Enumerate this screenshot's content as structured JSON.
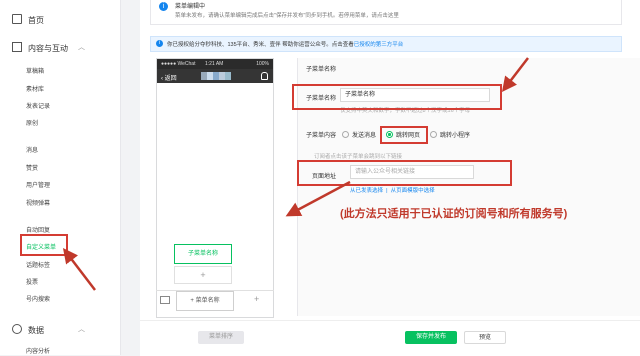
{
  "sidebar": {
    "home": "首页",
    "content_group": "内容与互动",
    "content_items": [
      "草稿箱",
      "素材库",
      "发表记录",
      "原创"
    ],
    "interaction_items": [
      "消息",
      "赞赏",
      "用户管理",
      "视频弹幕"
    ],
    "function_items": [
      "自动回复",
      "自定义菜单",
      "话题标签",
      "投票",
      "号内搜索"
    ],
    "data_group": "数据",
    "data_items": [
      "内容分析"
    ]
  },
  "notice": {
    "title": "菜单编辑中",
    "text": "菜单未发布，请确认菜单编辑完成后点击\"保存并发布\"同步到手机。若停用菜单，请点击这里",
    "link": "这里"
  },
  "auth_bar": {
    "text": "你已授权给分夺秒科技、135平台、秀米、壹伴  帮助你运营公众号。点击查看",
    "link": "已授权的第三方平台"
  },
  "phone": {
    "carrier": "●●●●● WeChat",
    "time": "1:21 AM",
    "battery": "100%",
    "back": "‹ 返回",
    "submenu_item": "子菜单名称",
    "submenu_add": "+",
    "menu_name": "+ 菜单名称",
    "menu_add": "+"
  },
  "editor": {
    "title": "子菜单名称",
    "name_label": "子菜单名称",
    "name_value": "子菜单名称",
    "name_hint": "仅支持中英文和数字，字数不超过8个汉字或16个字母",
    "content_label": "子菜单内容",
    "radios": [
      "发送消息",
      "跳转网页",
      "跳转小程序"
    ],
    "selected_radio": "跳转网页",
    "subscriber_hint": "订阅者点击该子菜单会跳到以下链接",
    "url_label": "页面地址",
    "url_placeholder": "请输入公众号相关链接",
    "link_from_published": "从已发表选择",
    "link_from_template": "从页面模版中选择"
  },
  "annotation": "(此方法只适用于已认证的订阅号和所有服务号)",
  "footer": {
    "sort_button": "菜单排序",
    "save_publish": "保存并发布",
    "preview": "预览"
  },
  "colors": {
    "accent": "#07c160",
    "highlight": "#d43c33",
    "link": "#1485ee"
  }
}
